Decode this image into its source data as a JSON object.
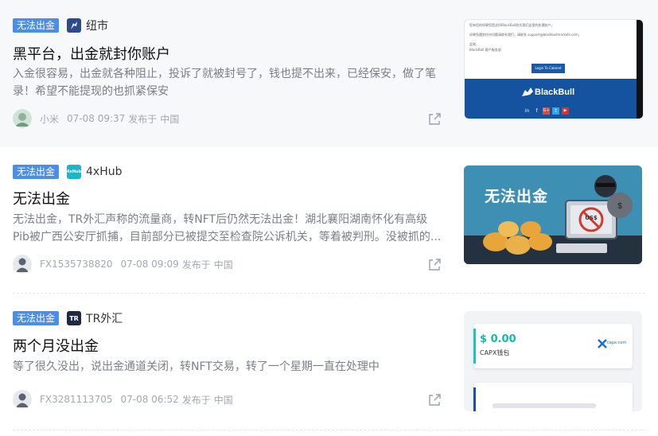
{
  "articles": [
    {
      "tag": "无法出金",
      "brand": "纽市",
      "brand_color": "#2c4a8c",
      "title": "黑平台，出金就封你账户",
      "desc": "入金很容易，出金就各种阻止，投诉了就被封号了，钱也提不出来，已经保安，做了笔录！希望不能提现的也抓紧保安",
      "author": "小米",
      "time": "07-08 09:37",
      "published": "发布于",
      "location": "中国",
      "thumb": {
        "email_line1": "您有您的如果您是这份BlackBull欧式我们这里的处理账户，",
        "email_line2": "如果您遇到任何问题请联系我们，请联系 support@blackbullmarkets.com，",
        "email_line3": "此致,",
        "email_line4": "BlackBull 客户服务部",
        "button": "Login To Cabinet",
        "logo": "BlackBull",
        "social": [
          "in",
          "f",
          "G+",
          "t",
          "▶"
        ]
      }
    },
    {
      "tag": "无法出金",
      "brand": "4xHub",
      "brand_logo_text": "4xHub",
      "brand_color": "#1bb6c9",
      "title": "无法出金",
      "desc": "无法出金，TR外汇声称的流量商，转NFT后仍然无法出金！湖北襄阳湖南怀化有高级Pib被广西公安厅抓捕，目前部分已被提交至检查院公诉机关，等着被判刑。没被抓的...",
      "author": "FX1535738820",
      "time": "07-08 09:09",
      "published": "发布于",
      "location": "中国",
      "thumb": {
        "caption": "无法出金",
        "monitor_text": "US$"
      }
    },
    {
      "tag": "无法出金",
      "brand": "TR外汇",
      "brand_logo_text": "TR",
      "brand_color": "#1e2a44",
      "title": "两个月没出金",
      "desc": "等了很久没出，说出金通道关闭，转NFT交易，转了一个星期一直在处理中",
      "author": "FX3281113705",
      "time": "07-08 06:52",
      "published": "发布于",
      "location": "中国",
      "thumb": {
        "amount": "$ 0.00",
        "wallet": "CAPX钱包",
        "logo": "capx.com"
      }
    }
  ],
  "colors": {
    "badge": "#4b8ee9",
    "meta": "#a3a8b0",
    "title": "#111111",
    "desc": "#7a7f87"
  }
}
